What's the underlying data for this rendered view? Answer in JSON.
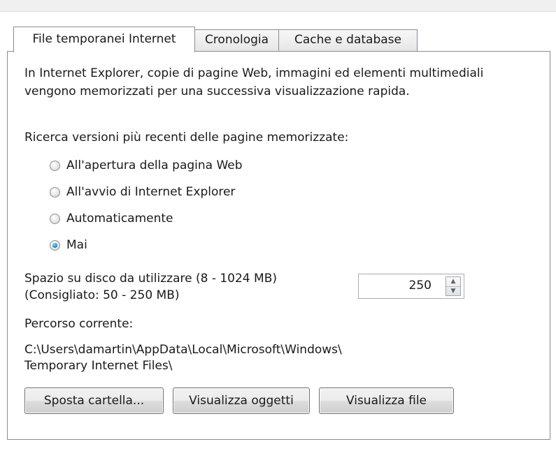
{
  "tabs": [
    {
      "label": "File temporanei Internet",
      "active": true
    },
    {
      "label": "Cronologia",
      "active": false
    },
    {
      "label": "Cache e database",
      "active": false
    }
  ],
  "description": {
    "line1": "In Internet Explorer, copie di pagine Web, immagini ed elementi multimediali",
    "line2": "vengono memorizzati per una successiva visualizzazione rapida."
  },
  "check_newer": {
    "label": "Ricerca versioni più recenti delle pagine memorizzate:",
    "options": [
      {
        "label": "All'apertura della pagina Web",
        "checked": false
      },
      {
        "label": "All'avvio di Internet Explorer",
        "checked": false
      },
      {
        "label": "Automaticamente",
        "checked": false
      },
      {
        "label": "Mai",
        "checked": true
      }
    ]
  },
  "disk_space": {
    "label_line1": "Spazio su disco da utilizzare (8 - 1024 MB)",
    "label_line2": "(Consigliato: 50 - 250 MB)",
    "value": "250"
  },
  "current_path": {
    "label": "Percorso corrente:",
    "line1": "C:\\Users\\damartin\\AppData\\Local\\Microsoft\\Windows\\",
    "line2": "Temporary Internet Files\\"
  },
  "buttons": {
    "move_folder": "Sposta cartella...",
    "view_objects": "Visualizza oggetti",
    "view_files": "Visualizza file"
  },
  "icons": {
    "spin_up": "chevron-up-icon",
    "spin_down": "chevron-down-icon"
  }
}
